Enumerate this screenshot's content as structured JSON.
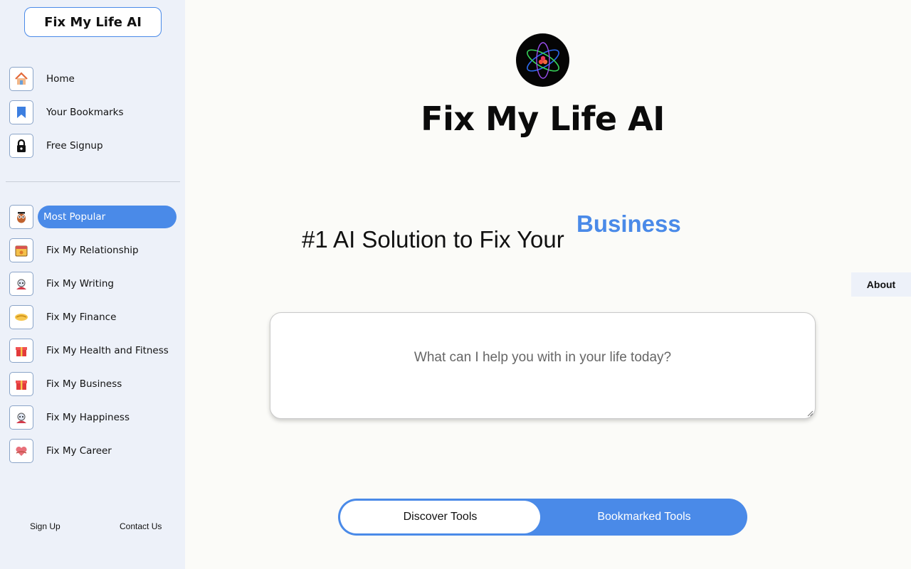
{
  "sidebar": {
    "brand": "Fix My Life AI",
    "top_nav": [
      {
        "label": "Home",
        "icon": "house-icon"
      },
      {
        "label": "Your Bookmarks",
        "icon": "bookmark-icon"
      },
      {
        "label": "Free Signup",
        "icon": "lock-icon"
      }
    ],
    "categories": [
      {
        "label": "Most Popular",
        "icon": "owl-icon",
        "active": true
      },
      {
        "label": "Fix My Relationship",
        "icon": "calendar-icon"
      },
      {
        "label": "Fix My Writing",
        "icon": "robot-icon"
      },
      {
        "label": "Fix My Finance",
        "icon": "handshake-icon"
      },
      {
        "label": "Fix My Health and Fitness",
        "icon": "gift-icon"
      },
      {
        "label": "Fix My Business",
        "icon": "gift-icon"
      },
      {
        "label": "Fix My Happiness",
        "icon": "robot-icon"
      },
      {
        "label": "Fix My Career",
        "icon": "heart-hands-icon"
      }
    ],
    "footer": {
      "sign_up": "Sign Up",
      "contact": "Contact Us"
    }
  },
  "main": {
    "title": "Fix My Life AI",
    "tagline": "#1 AI Solution to Fix Your",
    "rotating_word": "Business",
    "about": "About",
    "prompt_placeholder": "What can I help you with in your life today?",
    "tabs": {
      "discover": "Discover Tools",
      "bookmarked": "Bookmarked Tools"
    }
  },
  "colors": {
    "accent": "#4a8ae8",
    "sidebar_bg": "#edf1f9",
    "page_bg": "#fbfbf8"
  }
}
